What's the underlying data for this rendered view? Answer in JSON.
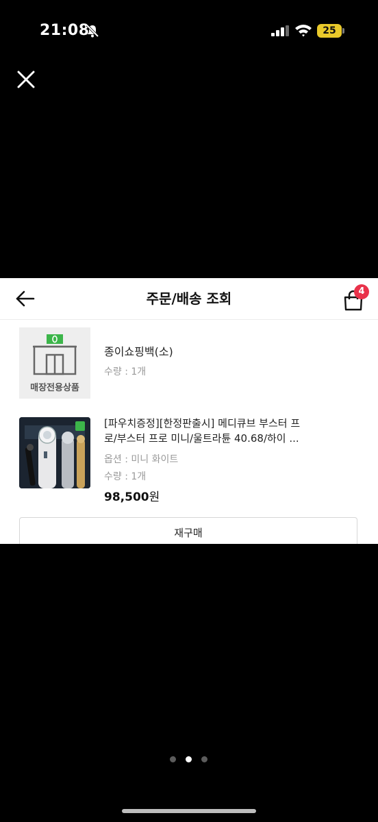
{
  "status_bar": {
    "time": "21:08",
    "battery_level": "25",
    "icons": [
      "bell-off-icon",
      "signal-icon",
      "wifi-icon",
      "battery-icon"
    ]
  },
  "viewer": {
    "close_icon": "close-icon",
    "page_dots": {
      "count": 3,
      "active_index": 1
    }
  },
  "screenshot": {
    "header": {
      "title": "주문/배송 조회",
      "back_icon": "back-arrow-icon",
      "bag_icon": "shopping-bag-icon",
      "bag_count": "4"
    },
    "items": [
      {
        "thumb_label": "매장전용상품",
        "name": "종이쇼핑백(소)",
        "quantity": "수량 : 1개"
      },
      {
        "title_line1": "[파우치증정][한정판출시] 메디큐브 부스터 프",
        "title_line2": "로/부스터 프로 미니/울트라튠 40.68/하이 ...",
        "option": "옵션 : 미니 화이트",
        "quantity": "수량 : 1개",
        "price_number": "98,500",
        "price_unit": "원"
      }
    ],
    "rebuy_label": "재구매"
  },
  "colors": {
    "background": "#000000",
    "card": "#ffffff",
    "badge": "#e9324a",
    "battery": "#e9c92a",
    "store_green": "#3cb54a"
  }
}
